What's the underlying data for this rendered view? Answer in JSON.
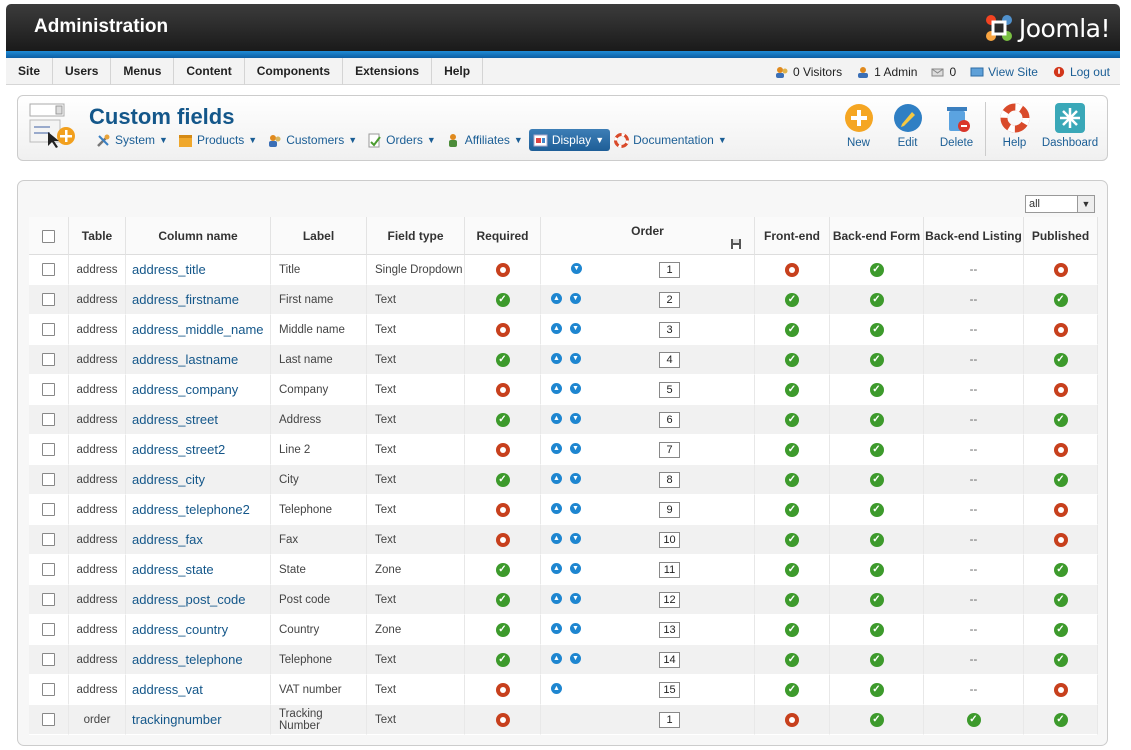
{
  "header": {
    "title": "Administration",
    "logo_text": "Joomla!"
  },
  "menubar": {
    "items": [
      "Site",
      "Users",
      "Menus",
      "Content",
      "Components",
      "Extensions",
      "Help"
    ]
  },
  "status": {
    "visitors": "0 Visitors",
    "admins": "1 Admin",
    "messages": "0",
    "view_site": "View Site",
    "logout": "Log out"
  },
  "page": {
    "title": "Custom fields"
  },
  "submenu": [
    {
      "label": "System",
      "icon": "tools-icon"
    },
    {
      "label": "Products",
      "icon": "box-icon"
    },
    {
      "label": "Customers",
      "icon": "users-icon"
    },
    {
      "label": "Orders",
      "icon": "orders-icon"
    },
    {
      "label": "Affiliates",
      "icon": "affiliates-icon"
    },
    {
      "label": "Display",
      "icon": "display-icon"
    },
    {
      "label": "Documentation",
      "icon": "lifebuoy-icon"
    }
  ],
  "actions": {
    "new": "New",
    "edit": "Edit",
    "delete": "Delete",
    "help": "Help",
    "dashboard": "Dashboard"
  },
  "filter": {
    "selected": "all"
  },
  "table": {
    "headers": {
      "table": "Table",
      "column_name": "Column name",
      "label": "Label",
      "field_type": "Field type",
      "required": "Required",
      "order": "Order",
      "front_end": "Front-end",
      "backend_form": "Back-end Form",
      "backend_listing": "Back-end Listing",
      "published": "Published"
    },
    "rows": [
      {
        "table": "address",
        "column": "address_title",
        "label": "Title",
        "type": "Single Dropdown",
        "required": false,
        "up": false,
        "down": true,
        "order": "1",
        "front": false,
        "bform": true,
        "blist": "--",
        "published": false
      },
      {
        "table": "address",
        "column": "address_firstname",
        "label": "First name",
        "type": "Text",
        "required": true,
        "up": true,
        "down": true,
        "order": "2",
        "front": true,
        "bform": true,
        "blist": "--",
        "published": true
      },
      {
        "table": "address",
        "column": "address_middle_name",
        "label": "Middle name",
        "type": "Text",
        "required": false,
        "up": true,
        "down": true,
        "order": "3",
        "front": true,
        "bform": true,
        "blist": "--",
        "published": false
      },
      {
        "table": "address",
        "column": "address_lastname",
        "label": "Last name",
        "type": "Text",
        "required": true,
        "up": true,
        "down": true,
        "order": "4",
        "front": true,
        "bform": true,
        "blist": "--",
        "published": true
      },
      {
        "table": "address",
        "column": "address_company",
        "label": "Company",
        "type": "Text",
        "required": false,
        "up": true,
        "down": true,
        "order": "5",
        "front": true,
        "bform": true,
        "blist": "--",
        "published": false
      },
      {
        "table": "address",
        "column": "address_street",
        "label": "Address",
        "type": "Text",
        "required": true,
        "up": true,
        "down": true,
        "order": "6",
        "front": true,
        "bform": true,
        "blist": "--",
        "published": true
      },
      {
        "table": "address",
        "column": "address_street2",
        "label": "Line 2",
        "type": "Text",
        "required": false,
        "up": true,
        "down": true,
        "order": "7",
        "front": true,
        "bform": true,
        "blist": "--",
        "published": false
      },
      {
        "table": "address",
        "column": "address_city",
        "label": "City",
        "type": "Text",
        "required": true,
        "up": true,
        "down": true,
        "order": "8",
        "front": true,
        "bform": true,
        "blist": "--",
        "published": true
      },
      {
        "table": "address",
        "column": "address_telephone2",
        "label": "Telephone",
        "type": "Text",
        "required": false,
        "up": true,
        "down": true,
        "order": "9",
        "front": true,
        "bform": true,
        "blist": "--",
        "published": false
      },
      {
        "table": "address",
        "column": "address_fax",
        "label": "Fax",
        "type": "Text",
        "required": false,
        "up": true,
        "down": true,
        "order": "10",
        "front": true,
        "bform": true,
        "blist": "--",
        "published": false
      },
      {
        "table": "address",
        "column": "address_state",
        "label": "State",
        "type": "Zone",
        "required": true,
        "up": true,
        "down": true,
        "order": "11",
        "front": true,
        "bform": true,
        "blist": "--",
        "published": true
      },
      {
        "table": "address",
        "column": "address_post_code",
        "label": "Post code",
        "type": "Text",
        "required": true,
        "up": true,
        "down": true,
        "order": "12",
        "front": true,
        "bform": true,
        "blist": "--",
        "published": true
      },
      {
        "table": "address",
        "column": "address_country",
        "label": "Country",
        "type": "Zone",
        "required": true,
        "up": true,
        "down": true,
        "order": "13",
        "front": true,
        "bform": true,
        "blist": "--",
        "published": true
      },
      {
        "table": "address",
        "column": "address_telephone",
        "label": "Telephone",
        "type": "Text",
        "required": true,
        "up": true,
        "down": true,
        "order": "14",
        "front": true,
        "bform": true,
        "blist": "--",
        "published": true
      },
      {
        "table": "address",
        "column": "address_vat",
        "label": "VAT number",
        "type": "Text",
        "required": false,
        "up": true,
        "down": false,
        "order": "15",
        "front": true,
        "bform": true,
        "blist": "--",
        "published": false
      },
      {
        "table": "order",
        "column": "trackingnumber",
        "label": "Tracking Number",
        "type": "Text",
        "required": false,
        "up": false,
        "down": false,
        "order": "1",
        "front": false,
        "bform": true,
        "blist": true,
        "published": true
      }
    ]
  },
  "colors": {
    "ok": "#3d9a2c",
    "no": "#c7401d",
    "link": "#14578a",
    "accent": "#1e86d0"
  }
}
